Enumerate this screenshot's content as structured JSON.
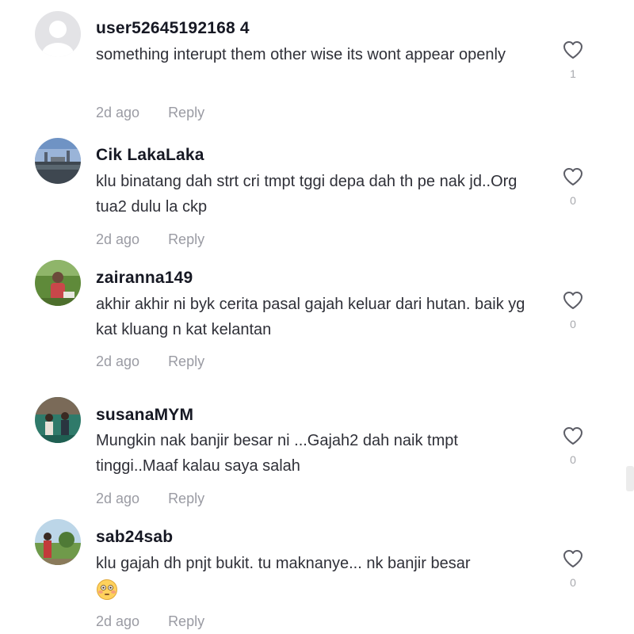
{
  "comments": [
    {
      "username": "user52645192168 4",
      "text": "something interupt them other wise its wont appear openly",
      "time": "2d ago",
      "reply": "Reply",
      "likes": "1",
      "avatar": "default-avatar"
    },
    {
      "username": "Cik LakaLaka",
      "text": "klu binatang dah strt cri tmpt tggi depa dah th pe nak jd..Org tua2 dulu la ckp",
      "time": "2d ago",
      "reply": "Reply",
      "likes": "0",
      "avatar": "landscape-avatar"
    },
    {
      "username": "zairanna149",
      "text": "akhir akhir ni byk cerita pasal gajah keluar dari hutan. baik yg kat kluang n kat kelantan",
      "time": "2d ago",
      "reply": "Reply",
      "likes": "0",
      "avatar": "person-avatar"
    },
    {
      "username": "susanaMYM",
      "text": "Mungkin nak banjir besar ni ...Gajah2 dah naik tmpt tinggi..Maaf kalau saya salah",
      "time": "2d ago",
      "reply": "Reply",
      "likes": "0",
      "avatar": "group-avatar"
    },
    {
      "username": "sab24sab",
      "text": "klu gajah dh pnjt bukit. tu maknanye... nk banjir besar",
      "emoji": "flushed-face-emoji",
      "time": "2d ago",
      "reply": "Reply",
      "likes": "0",
      "avatar": "outdoor-avatar"
    }
  ],
  "colors": {
    "username": "#161823",
    "text": "#2f3038",
    "meta": "#9a9ba3",
    "heart": "#5c5d66"
  }
}
